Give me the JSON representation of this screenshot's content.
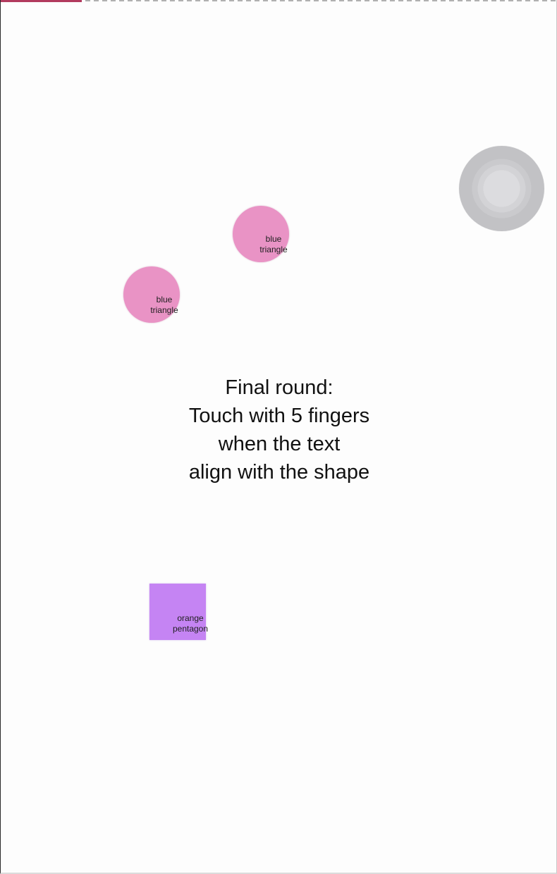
{
  "game": {
    "progress_fraction": 0.145,
    "progress_color": "#b23a5e",
    "instructions": [
      "Final round:",
      "Touch with 5 fingers",
      "when the text",
      "align with the shape"
    ],
    "shapes": [
      {
        "shape": "circle",
        "color": "#e993c5",
        "label_line1": "blue",
        "label_line2": "triangle"
      },
      {
        "shape": "circle",
        "color": "#e993c5",
        "label_line1": "blue",
        "label_line2": "triangle"
      },
      {
        "shape": "square",
        "color": "#c584f3",
        "label_line1": "orange",
        "label_line2": "pentagon"
      }
    ],
    "touch_indicator": {
      "icon": "touch-ring-icon",
      "color": "#c6c6c9"
    }
  }
}
